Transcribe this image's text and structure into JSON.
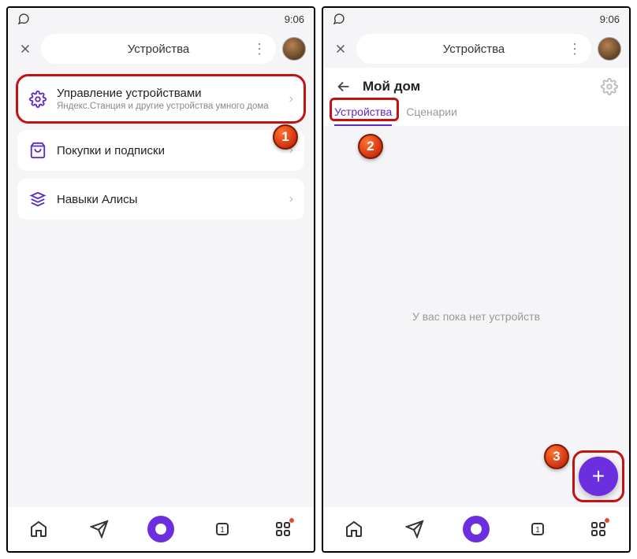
{
  "status": {
    "time": "9:06"
  },
  "header": {
    "title": "Устройства"
  },
  "screen1": {
    "manage": {
      "title": "Управление устройствами",
      "subtitle": "Яндекс.Станция и другие устройства умного дома"
    },
    "purchases": {
      "title": "Покупки и подписки"
    },
    "skills": {
      "title": "Навыки Алисы"
    }
  },
  "screen2": {
    "home_title": "Мой дом",
    "tabs": {
      "devices": "Устройства",
      "scenarios": "Сценарии"
    },
    "empty": "У вас пока нет устройств"
  },
  "markers": {
    "m1": "1",
    "m2": "2",
    "m3": "3"
  }
}
